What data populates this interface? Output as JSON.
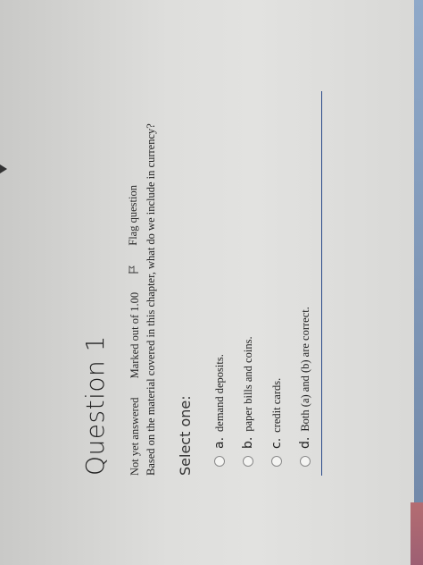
{
  "question": {
    "title": "Question 1",
    "status": "Not yet answered",
    "marks": "Marked out of 1.00",
    "flag_label": "Flag question",
    "text": "Based on the material covered in this chapter, what do we include in currency?"
  },
  "prompt": "Select one:",
  "options": [
    {
      "letter": "a.",
      "text": "demand deposits."
    },
    {
      "letter": "b.",
      "text": "paper bills and coins."
    },
    {
      "letter": "c.",
      "text": "credit cards."
    },
    {
      "letter": "d.",
      "text": "Both (a) and (b) are correct."
    }
  ],
  "colors": {
    "divider": "#2a4a8a",
    "background": "#dededc"
  }
}
